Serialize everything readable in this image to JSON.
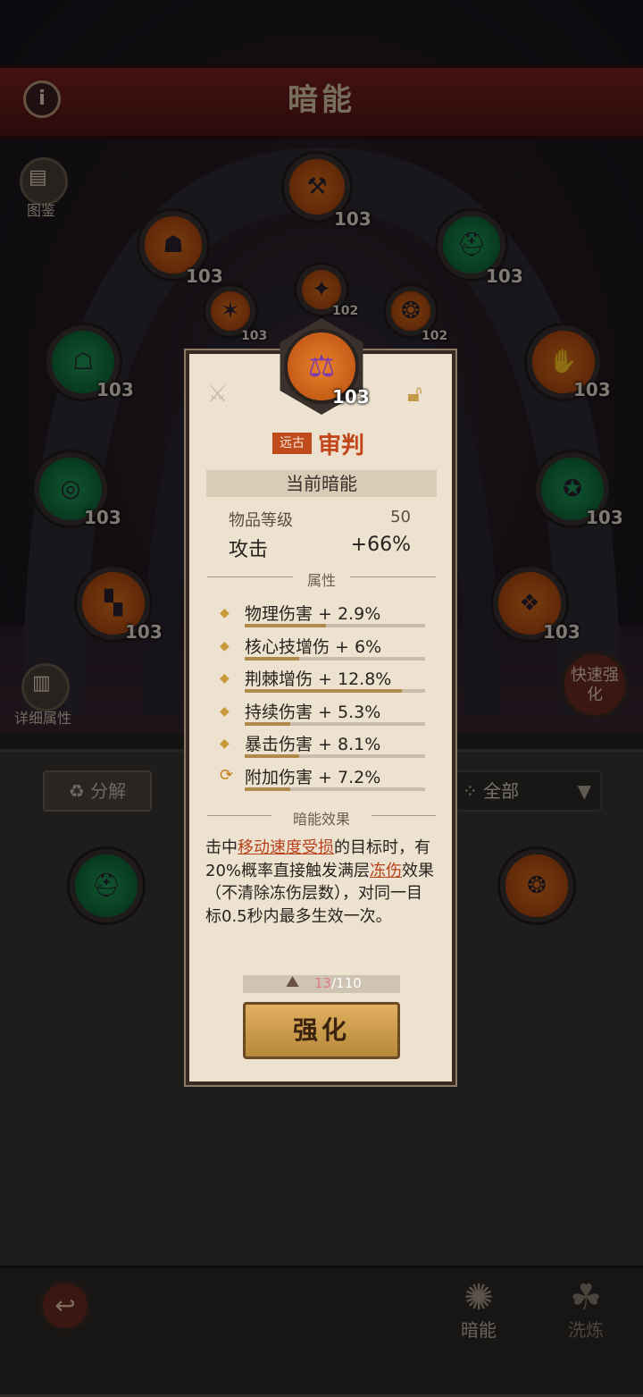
{
  "header": {
    "title": "暗能"
  },
  "side_buttons": {
    "codex_label": "图鉴",
    "details_label": "详细属性",
    "quick_upgrade_label": "快速强化"
  },
  "nodes": [
    {
      "level": "103",
      "color": "orange",
      "icon": "axe-icon"
    },
    {
      "level": "103",
      "color": "orange",
      "icon": "mask-icon"
    },
    {
      "level": "103",
      "color": "green",
      "icon": "helmet-icon"
    },
    {
      "level": "103",
      "color": "orange",
      "icon": "claw-icon"
    },
    {
      "level": "102",
      "color": "orange",
      "icon": "shield-icon"
    },
    {
      "level": "102",
      "color": "orange",
      "icon": "amulet-icon"
    },
    {
      "level": "103",
      "color": "green",
      "icon": "chest-armor-icon"
    },
    {
      "level": "103",
      "color": "orange",
      "icon": "gauntlet-icon"
    },
    {
      "level": "103",
      "color": "green",
      "icon": "ring-icon"
    },
    {
      "level": "103",
      "color": "green",
      "icon": "boots-icon"
    },
    {
      "level": "103",
      "color": "orange",
      "icon": "pants-icon"
    },
    {
      "level": "103",
      "color": "orange",
      "icon": "pendant-icon"
    }
  ],
  "bottom_panel": {
    "decompose_label": "分解",
    "filter_label": "全部"
  },
  "card": {
    "level": "103",
    "rarity": "远古",
    "name": "审判",
    "current_header": "当前暗能",
    "item_level_label": "物品等级",
    "item_level_value": "50",
    "attack_label": "攻击",
    "attack_value": "+66%",
    "attributes_header": "属性",
    "attributes": [
      {
        "text": "物理伤害 + 2.9%",
        "fill": 0.45
      },
      {
        "text": "核心技增伤 + 6%",
        "fill": 0.3
      },
      {
        "text": "荆棘增伤 + 12.8%",
        "fill": 0.87
      },
      {
        "text": "持续伤害 + 5.3%",
        "fill": 0.25
      },
      {
        "text": "暴击伤害 + 8.1%",
        "fill": 0.3
      },
      {
        "text": "附加伤害 + 7.2%",
        "fill": 0.25
      }
    ],
    "effect_header": "暗能效果",
    "effect_segments": [
      "击中",
      "移动速度受损",
      "的目标时，有20%概率直接触发满层",
      "冻伤",
      "效果（不清除冻伤层数），对同一目标0.5秒内最多生效一次。"
    ],
    "cost_current": "13",
    "cost_total": "/110",
    "upgrade_label": "强化"
  },
  "nav": {
    "dark_energy_label": "暗能",
    "refine_label": "洗炼"
  },
  "colors": {
    "accent": "#c2461a",
    "banner": "#6a1a1a",
    "card_bg": "#ece2cf"
  }
}
